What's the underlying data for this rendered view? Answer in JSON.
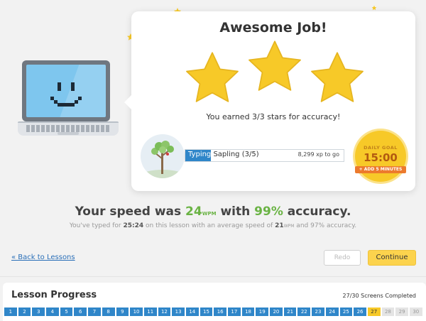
{
  "result_card": {
    "title": "Awesome Job!",
    "stars_earned": 3,
    "stars_total": 3,
    "accuracy_message": "You earned 3/3 stars for accuracy!"
  },
  "xp": {
    "label_highlighted": "Typing",
    "label_rest": " Sapling (3/5)",
    "progress_fraction": 0.16,
    "xp_to_go": "8,299 xp to go"
  },
  "daily_goal": {
    "label": "DAILY GOAL",
    "time": "15:00",
    "add_button": "+ ADD 5 MINUTES"
  },
  "summary": {
    "speed_prefix": "Your speed was ",
    "speed_value": "24",
    "speed_unit": "WPM",
    "speed_mid": " with ",
    "accuracy_value": "99%",
    "accuracy_suffix": " accuracy.",
    "sub_prefix": "You've typed for ",
    "sub_time": "25:24",
    "sub_mid": " on this lesson with an average speed of ",
    "sub_speed": "21",
    "sub_unit": "WPM",
    "sub_mid2": " and ",
    "sub_accuracy": "97%",
    "sub_suffix": " accuracy."
  },
  "actions": {
    "back_link": "« Back to Lessons",
    "redo": "Redo",
    "continue": "Continue"
  },
  "lesson_progress": {
    "title": "Lesson Progress",
    "count_text": "27/30 Screens Completed",
    "current_screen": 27,
    "screens": [
      "1",
      "2",
      "3",
      "4",
      "5",
      "6",
      "7",
      "8",
      "9",
      "10",
      "11",
      "12",
      "13",
      "14",
      "15",
      "16",
      "17",
      "18",
      "19",
      "20",
      "21",
      "22",
      "23",
      "24",
      "25",
      "26",
      "27",
      "28",
      "29",
      "30"
    ]
  },
  "colors": {
    "accent_blue": "#2f86c9",
    "star_yellow": "#f7c928",
    "green": "#6ab344",
    "continue_yellow": "#fcd34d"
  }
}
